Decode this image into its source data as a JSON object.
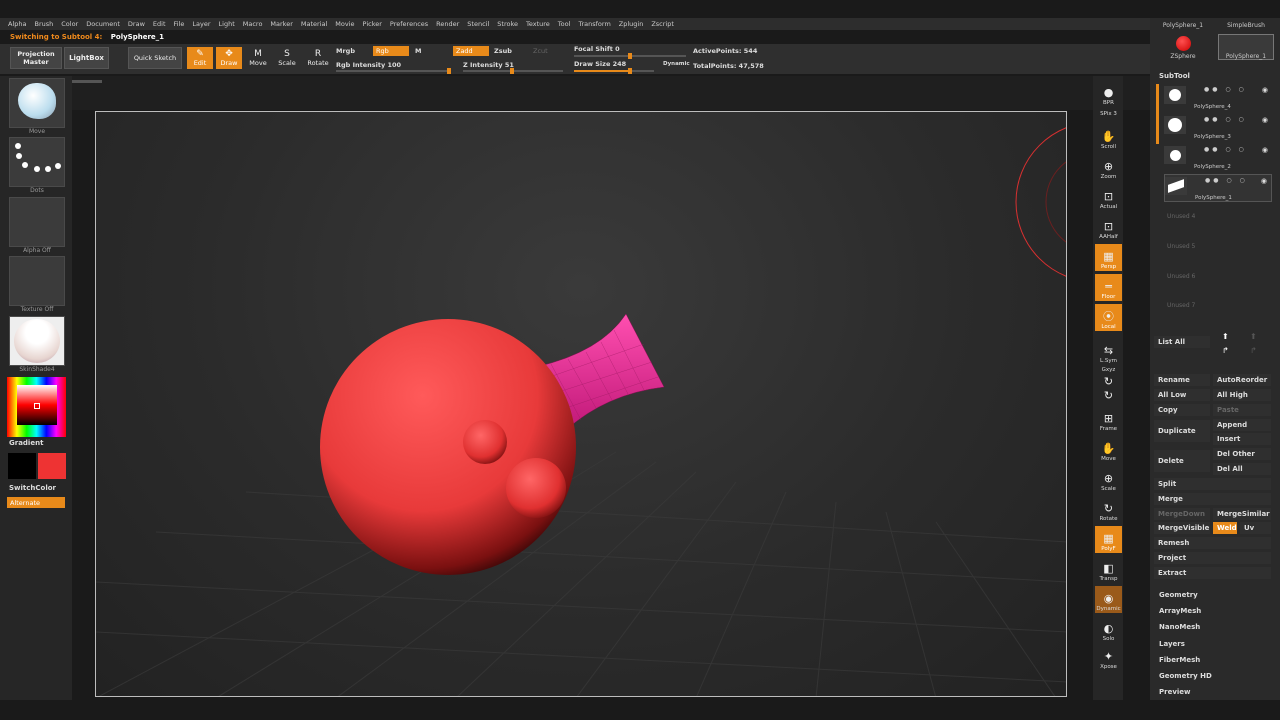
{
  "menu": [
    "Alpha",
    "Brush",
    "Color",
    "Document",
    "Draw",
    "Edit",
    "File",
    "Layer",
    "Light",
    "Macro",
    "Marker",
    "Material",
    "Movie",
    "Picker",
    "Preferences",
    "Render",
    "Stencil",
    "Stroke",
    "Texture",
    "Tool",
    "Transform",
    "Zplugin",
    "Zscript"
  ],
  "status": {
    "prefix": "Switching to Subtool 4:",
    "name": "PolySphere_1"
  },
  "toolbar": {
    "projection_master": "Projection Master",
    "lightbox": "LightBox",
    "quick_sketch": "Quick Sketch",
    "edit": "Edit",
    "draw": "Draw",
    "move": "Move",
    "scale": "Scale",
    "rotate": "Rotate",
    "mrgb": "Mrgb",
    "rgb": "Rgb",
    "m": "M",
    "rgb_intensity": "Rgb Intensity 100",
    "zadd": "Zadd",
    "zsub": "Zsub",
    "zcut": "Zcut",
    "z_intensity": "Z Intensity 51",
    "focal_shift": "Focal Shift 0",
    "draw_size": "Draw Size 248",
    "dynamic": "Dynamic",
    "active_points": "ActivePoints: 544",
    "total_points": "TotalPoints: 47,578",
    "rgb_intensity_value": 100,
    "z_intensity_value": 51,
    "draw_size_value": 248
  },
  "left_shelf": {
    "brush": "Move",
    "stroke": "Dots",
    "alpha": "Alpha Off",
    "texture": "Texture Off",
    "material": "SkinShade4",
    "gradient": "Gradient",
    "switch_color": "SwitchColor",
    "alternate": "Alternate",
    "main_color": "#ee3333",
    "secondary_color": "#000000"
  },
  "right_rail": [
    "BPR",
    "SPix 3",
    "Scroll",
    "Zoom",
    "Actual",
    "AAHalf",
    "Persp",
    "Floor",
    "Local",
    "L.Sym",
    "Gxyz",
    "",
    "",
    "Frame",
    "Move",
    "Scale",
    "Rotate",
    "PolyF",
    "Transp",
    "Dynamic",
    "Solo",
    "Xpose"
  ],
  "palette": {
    "top_tools": [
      "PolySphere_1",
      "SimpleBrush",
      "ZSphere",
      "PolySphere_1"
    ],
    "subtool_header": "SubTool",
    "subtools": [
      "PolySphere_4",
      "PolySphere_3",
      "PolySphere_2",
      "PolySphere_1"
    ],
    "unused": [
      "Unused 4",
      "Unused 5",
      "Unused 6",
      "Unused 7"
    ],
    "list_all": "List All",
    "rename": "Rename",
    "autoreorder": "AutoReorder",
    "all_low": "All Low",
    "all_high": "All High",
    "copy": "Copy",
    "paste": "Paste",
    "duplicate": "Duplicate",
    "append": "Append",
    "insert": "Insert",
    "delete": "Delete",
    "del_other": "Del Other",
    "del_all": "Del All",
    "split": "Split",
    "merge": "Merge",
    "mergedown": "MergeDown",
    "mergesimilar": "MergeSimilar",
    "mergevisible": "MergeVisible",
    "weld": "Weld",
    "uv": "Uv",
    "remesh": "Remesh",
    "project": "Project",
    "extract": "Extract",
    "sections": [
      "Geometry",
      "ArrayMesh",
      "NanoMesh",
      "Layers",
      "FiberMesh",
      "Geometry HD",
      "Preview"
    ]
  },
  "colors": {
    "accent": "#e88a1a",
    "model_body": "#e83a3a",
    "model_tube": "#e8309a"
  }
}
